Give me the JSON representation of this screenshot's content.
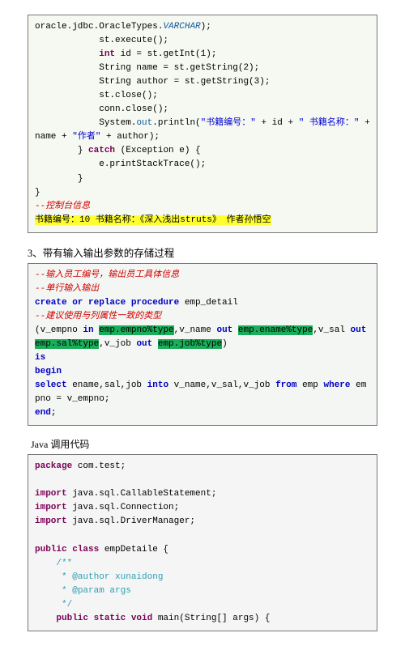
{
  "block1": {
    "l1a": "oracle.jdbc.OracleTypes.",
    "l1b": "VARCHAR",
    "l1c": ");",
    "l2": "            st.execute();",
    "l3a": "            ",
    "l3b": "int",
    "l3c": " id = st.getInt(1);",
    "l4": "            String name = st.getString(2);",
    "l5": "            String author = st.getString(3);",
    "l6": "            st.close();",
    "l7": "            conn.close();",
    "l8a": "            System.",
    "l8b": "out",
    "l8c": ".println(",
    "l8d": "\"书籍编号：\"",
    "l8e": " + id + ",
    "l8f": "\" 书籍名称：\"",
    "l8g": " + name + ",
    "l8h": "\"作者\"",
    "l8i": " + author);",
    "l9a": "        } ",
    "l9b": "catch",
    "l9c": " (Exception e) {",
    "l10": "            e.printStackTrace();",
    "l11": "        }",
    "l12": "}",
    "cm": "--控制台信息",
    "out": "书籍编号：10 书籍名称：《深入浅出struts》 作者孙悟空"
  },
  "h1": "3、带有输入输出参数的存储过程",
  "block2": {
    "c1": "--输入员工编号，输出员工具体信息",
    "c2": "--单行输入输出",
    "l3a": "create or replace procedure",
    "l3b": " emp_detail",
    "c4": "--建议使用与列属性一致的类型",
    "l5a": "(v_empno ",
    "l5b": "in",
    "l5c": " ",
    "l5d": "emp.empno%type",
    "l5e": ",v_name ",
    "l5f": "out",
    "l5g": " ",
    "l5h": "emp.ename%type",
    "l5i": ",v_sal ",
    "l5j": "out",
    "l5end": " ",
    "l6a": "emp.sal%type",
    "l6b": ",v_job ",
    "l6c": "out",
    "l6d": " ",
    "l6e": "emp.job%type",
    "l6f": ")",
    "l7": "is",
    "l8": "begin",
    "l9a": "select",
    "l9b": " ename,sal,job ",
    "l9c": "into",
    "l9d": " v_name,v_sal,v_job ",
    "l9e": "from",
    "l9f": " emp ",
    "l9g": "where",
    "l9h": " empno = v_empno;",
    "l10": "end",
    "l10b": ";"
  },
  "h2": "Java 调用代码",
  "block3": {
    "l1a": "package",
    "l1b": " com.test;",
    "blank": " ",
    "l2a": "import",
    "l2b": " java.sql.CallableStatement;",
    "l3a": "import",
    "l3b": " java.sql.Connection;",
    "l4a": "import",
    "l4b": " java.sql.DriverManager;",
    "l5a": "public class",
    "l5b": " empDetaile {",
    "d1": "    /**",
    "d2": "     * @author xunaidong",
    "d3": "     * @param args",
    "d4": "     */",
    "l6a": "    ",
    "l6b": "public static void",
    "l6c": " main(String[] args) {"
  }
}
